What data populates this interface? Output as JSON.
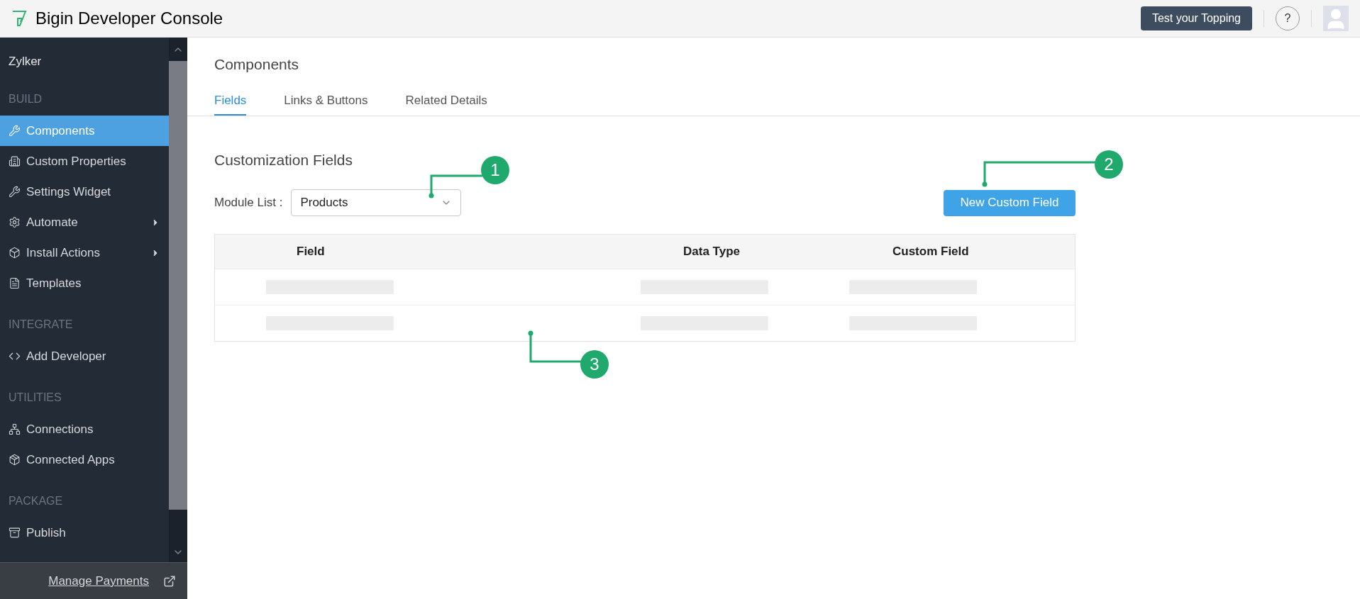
{
  "header": {
    "title": "Bigin Developer Console",
    "test_button": "Test your Topping",
    "help": "?"
  },
  "sidebar": {
    "org": "Zylker",
    "sections": [
      {
        "heading": "BUILD",
        "items": [
          {
            "label": "Components",
            "selected": true,
            "expandable": false
          },
          {
            "label": "Custom Properties",
            "selected": false,
            "expandable": false
          },
          {
            "label": "Settings Widget",
            "selected": false,
            "expandable": false
          },
          {
            "label": "Automate",
            "selected": false,
            "expandable": true
          },
          {
            "label": "Install Actions",
            "selected": false,
            "expandable": true
          },
          {
            "label": "Templates",
            "selected": false,
            "expandable": false
          }
        ]
      },
      {
        "heading": "INTEGRATE",
        "items": [
          {
            "label": "Add Developer",
            "selected": false,
            "expandable": false
          }
        ]
      },
      {
        "heading": "UTILITIES",
        "items": [
          {
            "label": "Connections",
            "selected": false,
            "expandable": false
          },
          {
            "label": "Connected Apps",
            "selected": false,
            "expandable": false
          }
        ]
      },
      {
        "heading": "PACKAGE",
        "items": [
          {
            "label": "Publish",
            "selected": false,
            "expandable": false
          }
        ]
      }
    ],
    "footer_link": "Manage Payments"
  },
  "page": {
    "title": "Components",
    "tabs": [
      {
        "label": "Fields",
        "selected": true
      },
      {
        "label": "Links & Buttons",
        "selected": false
      },
      {
        "label": "Related Details",
        "selected": false
      }
    ],
    "section_title": "Customization Fields",
    "module_label": "Module List :",
    "module_value": "Products",
    "new_button": "New Custom Field",
    "table": {
      "columns": [
        "Field",
        "Data Type",
        "Custom Field"
      ],
      "rows": [
        {
          "loading": true
        },
        {
          "loading": true
        }
      ]
    }
  },
  "callouts": [
    {
      "label": "1"
    },
    {
      "label": "2"
    },
    {
      "label": "3"
    }
  ]
}
